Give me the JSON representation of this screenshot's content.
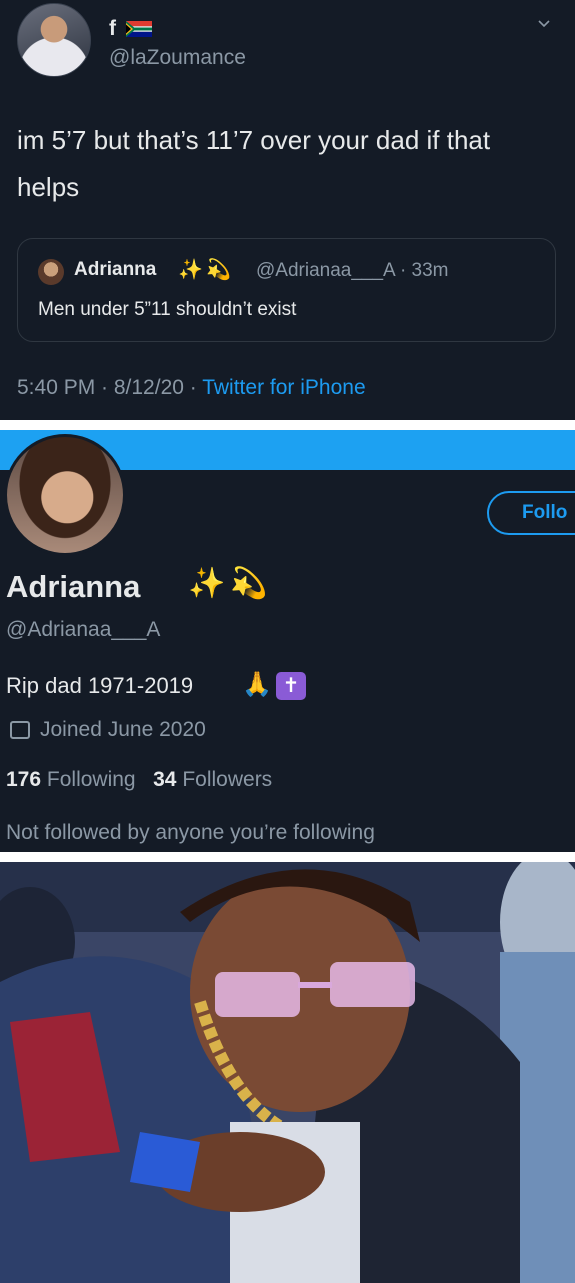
{
  "tweet": {
    "display_name": "f",
    "handle": "@laZoumance",
    "text": "im 5’7 but that’s 11’7 over your dad if that helps",
    "quoted": {
      "name": "Adrianna",
      "handle_time": "@Adrianaa___A · 33m",
      "text": "Men under 5”11 shouldn’t exist"
    },
    "timestamp": "5:40 PM · 8/12/20 · ",
    "source": "Twitter for iPhone"
  },
  "profile": {
    "follow_label": "Follo",
    "name": "Adrianna",
    "handle": "@Adrianaa___A",
    "bio": "Rip dad 1971-2019",
    "joined": "Joined June 2020",
    "following_count": "176",
    "following_label": "Following",
    "followers_count": "34",
    "followers_label": "Followers",
    "not_followed": "Not followed by anyone you’re following"
  },
  "icons": {
    "sparkles": "sparkles-icon",
    "dizzy": "dizzy-icon",
    "pray": "folded-hands-icon",
    "cross": "latin-cross-icon",
    "calendar": "calendar-icon",
    "chevron": "chevron-down-icon",
    "flag": "south-africa-flag-icon"
  },
  "colors": {
    "background": "#141b26",
    "accent": "#1d9bf0",
    "banner": "#1da1f2",
    "text_primary": "#e7e9ea",
    "text_secondary": "#8b98a5"
  }
}
